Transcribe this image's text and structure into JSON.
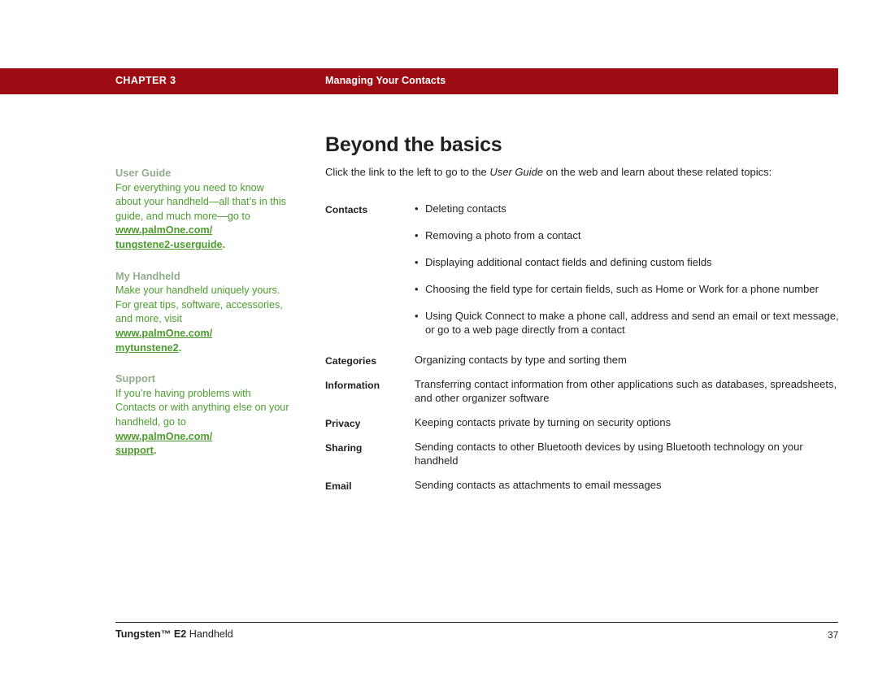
{
  "header": {
    "chapter": "CHAPTER 3",
    "title": "Managing Your Contacts",
    "band_color": "#9C0C12"
  },
  "page_title": "Beyond the basics",
  "intro": {
    "before": "Click the link to the left to go to the ",
    "italic": "User Guide",
    "after": " on the web and learn about these related topics:"
  },
  "sidebar": {
    "accent_color": "#4C9C2E",
    "blocks": [
      {
        "heading": "User Guide",
        "body": "For everything you need to know about your handheld—all that’s in this guide, and much more—go to",
        "link_line1": "www.palmOne.com/",
        "link_line2": "tungstene2-userguide",
        "trailing": "."
      },
      {
        "heading": "My Handheld",
        "body": "Make your handheld uniquely yours. For great tips, software, accessories, and more, visit",
        "link_line1": "www.palmOne.com/",
        "link_line2": "mytunstene2",
        "trailing": "."
      },
      {
        "heading": "Support",
        "body": "If you’re having problems with Contacts or with anything else on your handheld, go to",
        "link_line1": "www.palmOne.com/",
        "link_line2": "support",
        "trailing": "."
      }
    ]
  },
  "topics": [
    {
      "label": "Contacts",
      "bullets": [
        "Deleting contacts",
        "Removing a photo from a contact",
        "Displaying additional contact fields and defining custom fields",
        "Choosing the field type for certain fields, such as Home or Work for a phone number",
        "Using Quick Connect to make a phone call, address and send an email or text message, or go to a web page directly from a contact"
      ]
    },
    {
      "label": "Categories",
      "text": "Organizing contacts by type and sorting them"
    },
    {
      "label": "Information",
      "text": "Transferring contact information from other applications such as databases, spreadsheets, and other organizer software"
    },
    {
      "label": "Privacy",
      "text": "Keeping contacts private by turning on security options"
    },
    {
      "label": "Sharing",
      "text": "Sending contacts to other Bluetooth devices by using Bluetooth technology on your handheld"
    },
    {
      "label": "Email",
      "text": "Sending contacts as attachments to email messages"
    }
  ],
  "footer": {
    "product_bold": "Tungsten™ E2",
    "product_rest": " Handheld",
    "page_number": "37"
  }
}
